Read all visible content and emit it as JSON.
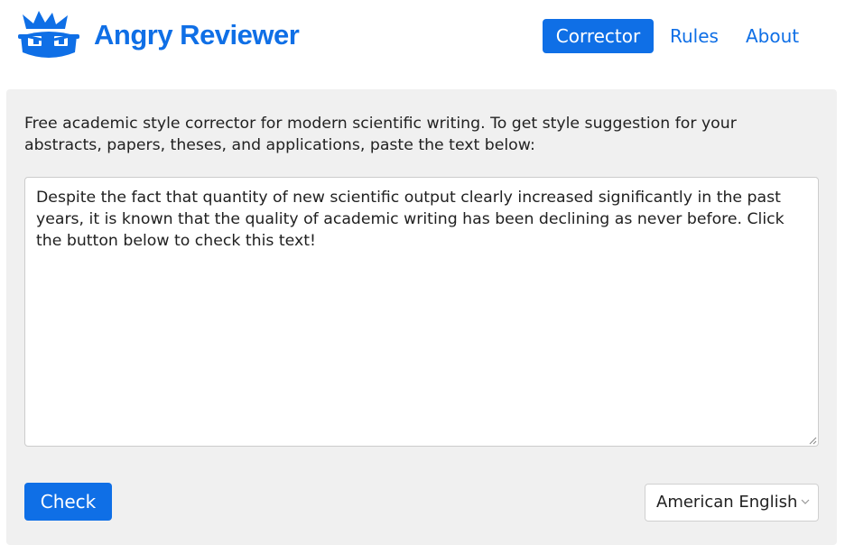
{
  "app": {
    "brand": "Angry Reviewer",
    "logo_icon": "angry-reviewer-logo",
    "accent_color": "#0f6fe6"
  },
  "nav": {
    "items": [
      {
        "label": "Corrector",
        "active": true
      },
      {
        "label": "Rules",
        "active": false
      },
      {
        "label": "About",
        "active": false
      }
    ]
  },
  "main": {
    "intro": "Free academic style corrector for modern scientific writing. To get style suggestion for your abstracts, papers, theses, and applications, paste the text below:",
    "textarea_value": "Despite the fact that quantity of new scientific output clearly increased significantly in the past years, it is known that the quality of academic writing has been declining as never before. Click the button below to check this text!",
    "check_label": "Check",
    "language_selected": "American English"
  }
}
